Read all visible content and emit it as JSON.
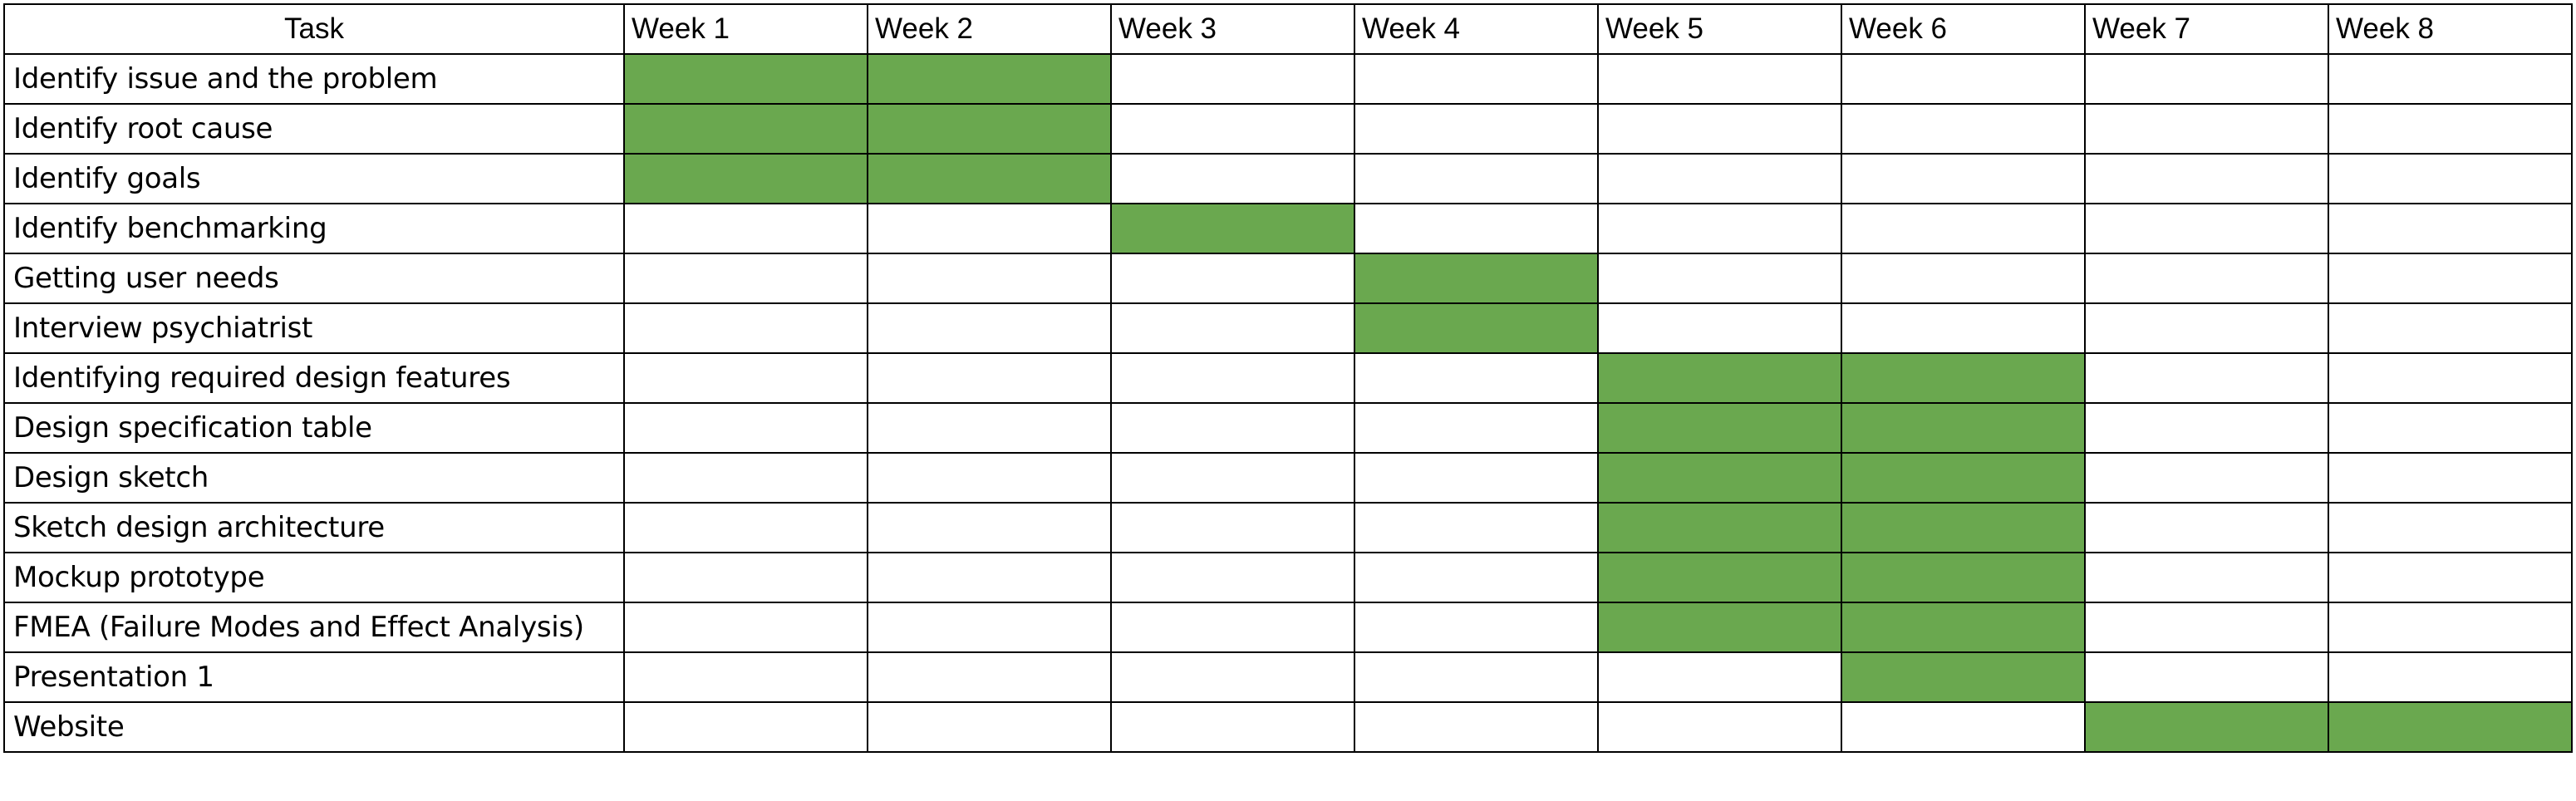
{
  "chart_data": {
    "type": "table",
    "subtype": "gantt",
    "columns": [
      "Task",
      "Week 1",
      "Week 2",
      "Week 3",
      "Week 4",
      "Week 5",
      "Week 6",
      "Week 7",
      "Week 8"
    ],
    "rows": [
      {
        "task": "Identify issue and the problem",
        "weeks": [
          1,
          2
        ]
      },
      {
        "task": "Identify root cause",
        "weeks": [
          1,
          2
        ]
      },
      {
        "task": "Identify goals",
        "weeks": [
          1,
          2
        ]
      },
      {
        "task": "Identify benchmarking",
        "weeks": [
          3
        ]
      },
      {
        "task": "Getting user needs",
        "weeks": [
          4
        ]
      },
      {
        "task": "Interview psychiatrist",
        "weeks": [
          4
        ]
      },
      {
        "task": "Identifying required design features",
        "weeks": [
          5,
          6
        ]
      },
      {
        "task": "Design specification table",
        "weeks": [
          5,
          6
        ]
      },
      {
        "task": "Design sketch",
        "weeks": [
          5,
          6
        ]
      },
      {
        "task": "Sketch design architecture",
        "weeks": [
          5,
          6
        ]
      },
      {
        "task": "Mockup prototype",
        "weeks": [
          5,
          6
        ]
      },
      {
        "task": "FMEA (Failure Modes and Effect Analysis)",
        "weeks": [
          5,
          6
        ]
      },
      {
        "task": "Presentation 1",
        "weeks": [
          6
        ]
      },
      {
        "task": "Website",
        "weeks": [
          7,
          8
        ]
      }
    ],
    "active_color": "#6aa84f",
    "grid": true
  }
}
